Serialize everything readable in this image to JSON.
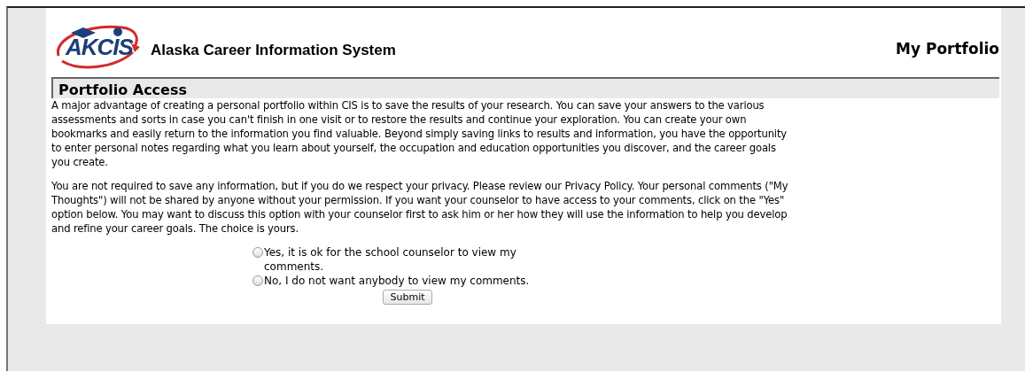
{
  "header": {
    "logo_text": "AKCIS",
    "site_title": "Alaska Career Information System",
    "page_title": "My Portfolio"
  },
  "section": {
    "title": "Portfolio Access",
    "paragraphs": [
      "A major advantage of creating a personal portfolio within CIS is to save the results of your research. You can save your answers to the various assessments and sorts in case you can't finish in one visit or to restore the results and continue your exploration. You can create your own bookmarks and easily return to the information you find valuable. Beyond simply saving links to results and information, you have the opportunity to enter personal notes regarding what you learn about yourself, the occupation and education opportunities you discover, and the career goals you create.",
      "You are not required to save any information, but if you do we respect your privacy. Please review our Privacy Policy. Your personal comments (\"My Thoughts\") will not be shared by anyone without your permission. If you want your counselor to have access to your comments, click on the \"Yes\" option below. You may want to discuss this option with your counselor first to ask him or her how they will use the information to help you develop and refine your career goals. The choice is yours."
    ]
  },
  "options": [
    {
      "label": "Yes, it is ok for the school counselor to view my comments.",
      "selected": false
    },
    {
      "label": "No, I do not want anybody to view my comments.",
      "selected": false
    }
  ],
  "submit": "Submit"
}
